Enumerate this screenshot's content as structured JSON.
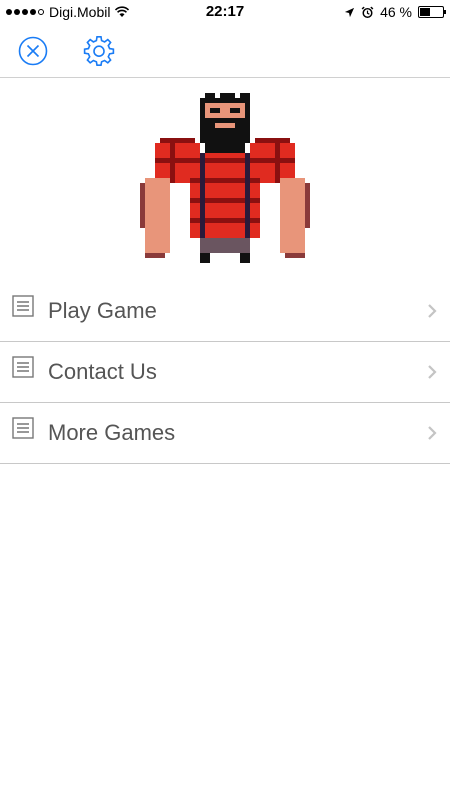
{
  "status_bar": {
    "carrier": "Digi.Mobil",
    "time": "22:17",
    "battery_percent_label": "46 %",
    "battery_level": 0.46
  },
  "nav_bar": {
    "left_icon": "close-circle-icon",
    "right_icon": "gear-icon",
    "accent_color": "#1a7cf5"
  },
  "menu": {
    "items": [
      {
        "label": "Play Game",
        "icon": "document-icon"
      },
      {
        "label": "Contact Us",
        "icon": "document-icon"
      },
      {
        "label": "More Games",
        "icon": "document-icon"
      }
    ]
  },
  "colors": {
    "shirt_red": "#e02b20",
    "shirt_dark": "#8a1010",
    "skin": "#e8957a",
    "hair": "#111111",
    "divider": "#c8c8c8"
  }
}
